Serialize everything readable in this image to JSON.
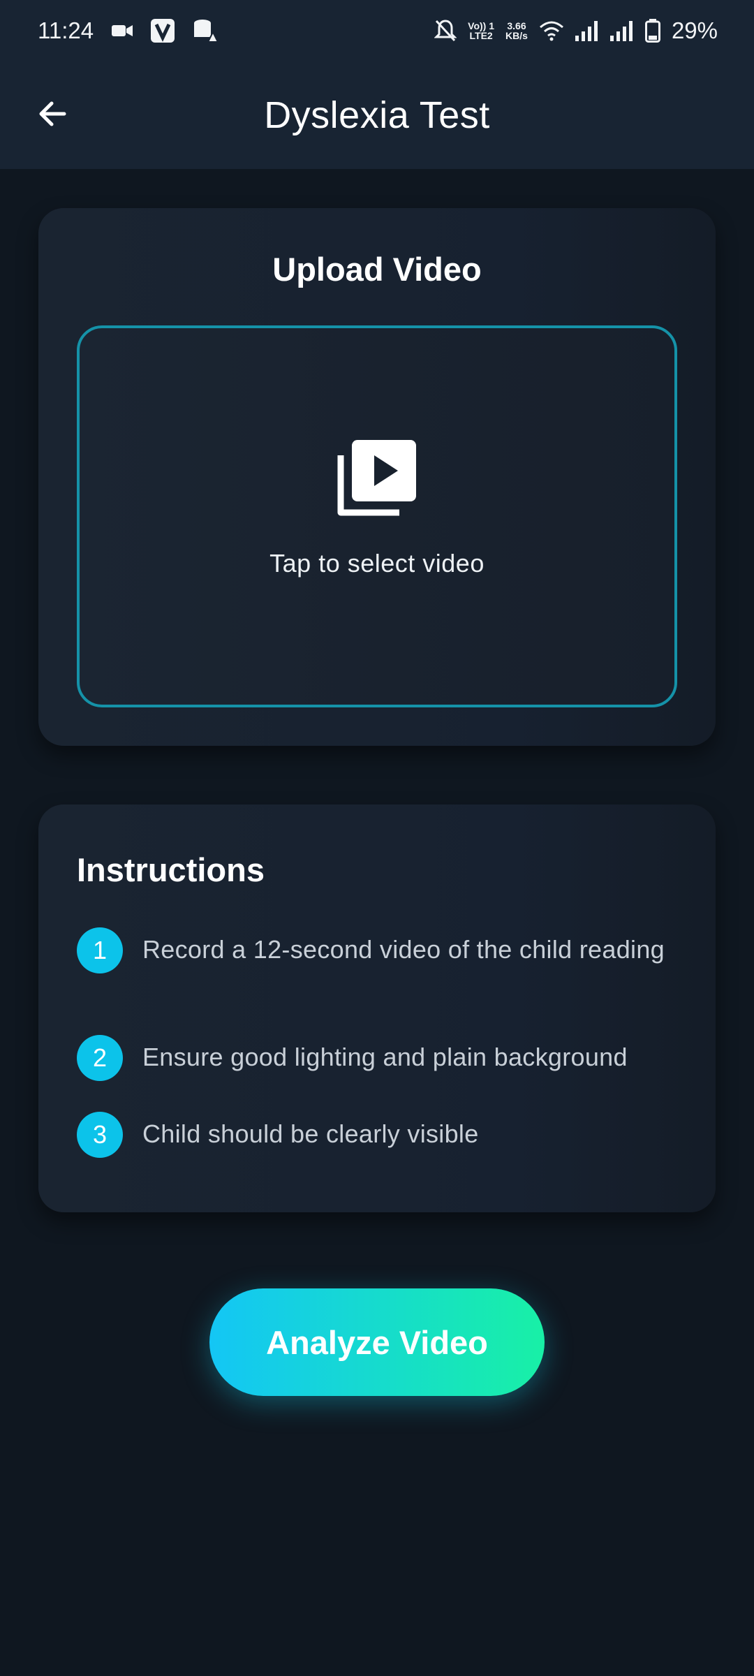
{
  "status_bar": {
    "time": "11:24",
    "net_top": "Vo)) 1",
    "net_bottom": "LTE2",
    "speed_value": "3.66",
    "speed_unit": "KB/s",
    "battery": "29%",
    "icons": [
      "video-camera-icon",
      "v-app-icon",
      "storage-warning-icon",
      "bell-off-icon",
      "wifi-icon",
      "signal-icon",
      "signal-icon",
      "battery-icon"
    ]
  },
  "app_bar": {
    "title": "Dyslexia Test",
    "back_icon": "arrow-left-icon"
  },
  "upload": {
    "title": "Upload Video",
    "prompt": "Tap to select video",
    "icon": "video-library-icon",
    "accent": "#1592a8"
  },
  "instructions": {
    "title": "Instructions",
    "steps": [
      {
        "number": "1",
        "text": "Record a 12-second video of the child reading"
      },
      {
        "number": "2",
        "text": "Ensure good lighting and plain background"
      },
      {
        "number": "3",
        "text": "Child should be clearly visible"
      }
    ],
    "badge_color": "#0cc3ea"
  },
  "actions": {
    "analyze_label": "Analyze Video",
    "gradient_start": "#14c6f5",
    "gradient_end": "#18f0a6"
  }
}
